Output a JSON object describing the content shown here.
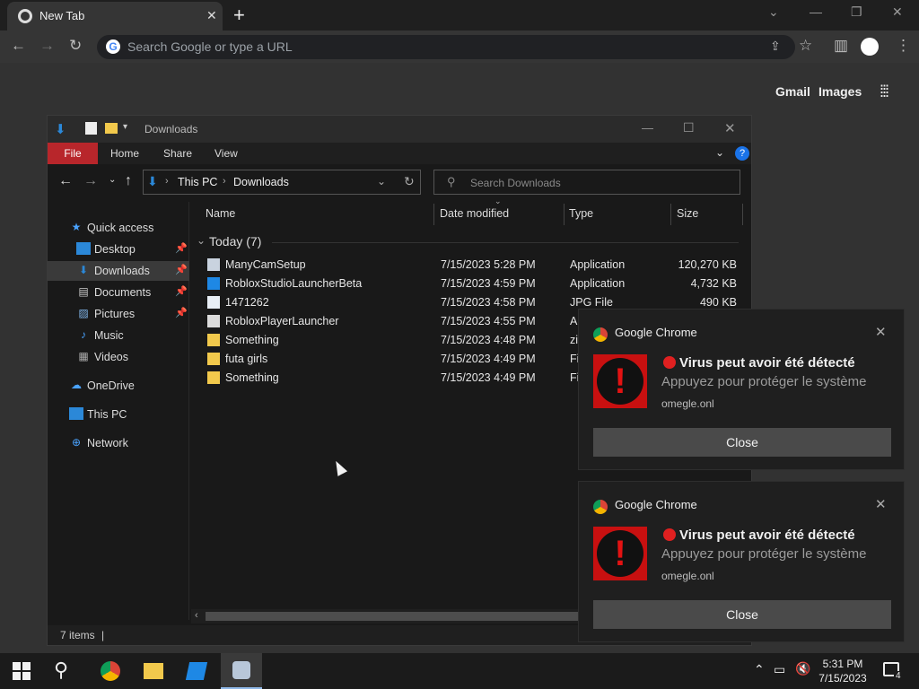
{
  "browser": {
    "tab_title": "New Tab",
    "omnibox_placeholder": "Search Google or type a URL",
    "ntp": {
      "gmail": "Gmail",
      "images": "Images"
    }
  },
  "explorer": {
    "title": "Downloads",
    "ribbon": {
      "file": "File",
      "home": "Home",
      "share": "Share",
      "view": "View"
    },
    "breadcrumb": {
      "root": "This PC",
      "current": "Downloads"
    },
    "search_placeholder": "Search Downloads",
    "nav": {
      "quick_access": "Quick access",
      "desktop": "Desktop",
      "downloads": "Downloads",
      "documents": "Documents",
      "pictures": "Pictures",
      "music": "Music",
      "videos": "Videos",
      "onedrive": "OneDrive",
      "this_pc": "This PC",
      "network": "Network"
    },
    "columns": {
      "name": "Name",
      "date": "Date modified",
      "type": "Type",
      "size": "Size"
    },
    "group": "Today (7)",
    "rows": [
      {
        "name": "ManyCamSetup",
        "date": "7/15/2023 5:28 PM",
        "type": "Application",
        "size": "120,270 KB"
      },
      {
        "name": "RobloxStudioLauncherBeta",
        "date": "7/15/2023 4:59 PM",
        "type": "Application",
        "size": "4,732 KB"
      },
      {
        "name": "1471262",
        "date": "7/15/2023 4:58 PM",
        "type": "JPG File",
        "size": "490 KB"
      },
      {
        "name": "RobloxPlayerLauncher",
        "date": "7/15/2023 4:55 PM",
        "type": "Ap",
        "size": ""
      },
      {
        "name": "Something",
        "date": "7/15/2023 4:48 PM",
        "type": "zi",
        "size": ""
      },
      {
        "name": "futa girls",
        "date": "7/15/2023 4:49 PM",
        "type": "Fi",
        "size": ""
      },
      {
        "name": "Something",
        "date": "7/15/2023 4:49 PM",
        "type": "Fi",
        "size": ""
      }
    ],
    "status": "7 items"
  },
  "notifications": [
    {
      "app": "Google Chrome",
      "headline": "Virus peut avoir été détecté",
      "body": "Appuyez pour protéger le système",
      "source": "omegle.onl",
      "button": "Close"
    },
    {
      "app": "Google Chrome",
      "headline": "Virus peut avoir été détecté",
      "body": "Appuyez pour protéger le système",
      "source": "omegle.onl",
      "button": "Close"
    }
  ],
  "taskbar": {
    "time": "5:31 PM",
    "date": "7/15/2023",
    "notification_count": "4"
  },
  "colors": {
    "ribbon_file": "#b8262b",
    "alert_red": "#c81010",
    "accent_blue": "#1a73e8"
  }
}
